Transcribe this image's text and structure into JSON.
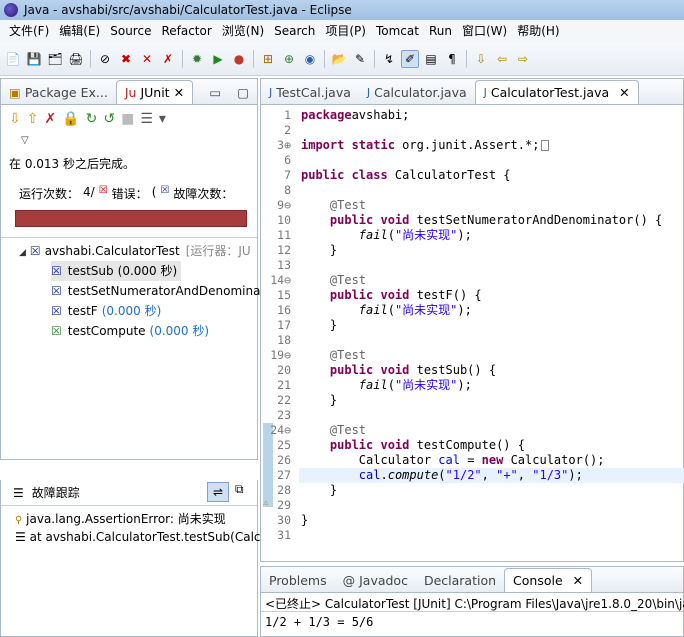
{
  "window": {
    "title": "Java - avshabi/src/avshabi/CalculatorTest.java - Eclipse"
  },
  "menu": [
    "文件(F)",
    "编辑(E)",
    "Source",
    "Refactor",
    "浏览(N)",
    "Search",
    "项目(P)",
    "Tomcat",
    "Run",
    "窗口(W)",
    "帮助(H)"
  ],
  "left_tabs": {
    "package": "Package Ex...",
    "junit": "JUnit"
  },
  "junit": {
    "finished": "在 0.013 秒之后完成。",
    "runs_label": "运行次数：",
    "runs_value": "4/",
    "errors_label": "错误：",
    "errors_value": "(",
    "failures_label": "故障次数：",
    "failures_value": "",
    "tree": {
      "root": "avshabi.CalculatorTest",
      "root_suffix": "[运行器：JU",
      "items": [
        {
          "name": "testSub",
          "time": "(0.000 秒)"
        },
        {
          "name": "testSetNumeratorAndDenomina",
          "time": ""
        },
        {
          "name": "testF",
          "time": "(0.000 秒)"
        },
        {
          "name": "testCompute",
          "time": "(0.000 秒)"
        }
      ]
    },
    "trace_title": "故障跟踪",
    "trace": [
      "java.lang.AssertionError: 尚未实现",
      "at avshabi.CalculatorTest.testSub(Calc"
    ]
  },
  "editor_tabs": [
    "TestCal.java",
    "Calculator.java",
    "CalculatorTest.java"
  ],
  "code": [
    {
      "n": "1",
      "t": [
        [
          "kw",
          "package"
        ],
        [
          "",
          "avshabi;"
        ]
      ]
    },
    {
      "n": "2",
      "t": []
    },
    {
      "n": "3⊕",
      "t": [
        [
          "kw",
          "import static"
        ],
        [
          "",
          " org.junit.Assert.*;"
        ],
        [
          "box",
          ""
        ]
      ]
    },
    {
      "n": "6",
      "t": []
    },
    {
      "n": "7",
      "t": [
        [
          "kw",
          "public class"
        ],
        [
          "",
          " CalculatorTest {"
        ]
      ]
    },
    {
      "n": "8",
      "t": []
    },
    {
      "n": "9⊖",
      "t": [
        [
          "ann",
          "    @Test"
        ]
      ]
    },
    {
      "n": "10",
      "t": [
        [
          "kw",
          "    public void"
        ],
        [
          "",
          " testSetNumeratorAndDenominator() {"
        ]
      ]
    },
    {
      "n": "11",
      "t": [
        [
          "it",
          "        fail"
        ],
        [
          "",
          "("
        ],
        [
          "str",
          "\"尚未实现\""
        ],
        [
          "",
          ");"
        ]
      ]
    },
    {
      "n": "12",
      "t": [
        [
          "",
          "    }"
        ]
      ]
    },
    {
      "n": "13",
      "t": []
    },
    {
      "n": "14⊖",
      "t": [
        [
          "ann",
          "    @Test"
        ]
      ]
    },
    {
      "n": "15",
      "t": [
        [
          "kw",
          "    public void"
        ],
        [
          "",
          " testF() {"
        ]
      ]
    },
    {
      "n": "16",
      "t": [
        [
          "it",
          "        fail"
        ],
        [
          "",
          "("
        ],
        [
          "str",
          "\"尚未实现\""
        ],
        [
          "",
          ");"
        ]
      ]
    },
    {
      "n": "17",
      "t": [
        [
          "",
          "    }"
        ]
      ]
    },
    {
      "n": "18",
      "t": []
    },
    {
      "n": "19⊖",
      "t": [
        [
          "ann",
          "    @Test"
        ]
      ]
    },
    {
      "n": "20",
      "t": [
        [
          "kw",
          "    public void"
        ],
        [
          "",
          " testSub() {"
        ]
      ]
    },
    {
      "n": "21",
      "t": [
        [
          "it",
          "        fail"
        ],
        [
          "",
          "("
        ],
        [
          "str",
          "\"尚未实现\""
        ],
        [
          "",
          ");"
        ]
      ]
    },
    {
      "n": "22",
      "t": [
        [
          "",
          "    }"
        ]
      ]
    },
    {
      "n": "23",
      "t": []
    },
    {
      "n": "24⊖",
      "t": [
        [
          "ann",
          "    @Test"
        ]
      ]
    },
    {
      "n": "25",
      "t": [
        [
          "kw",
          "    public void"
        ],
        [
          "",
          " testCompute() {"
        ]
      ]
    },
    {
      "n": "26",
      "t": [
        [
          "",
          "        Calculator "
        ],
        [
          "fieldv",
          "cal"
        ],
        [
          "",
          " = "
        ],
        [
          "kw",
          "new"
        ],
        [
          "",
          " Calculator();"
        ]
      ]
    },
    {
      "n": "27",
      "t": [
        [
          "fieldv",
          "        cal"
        ],
        [
          "",
          "."
        ],
        [
          "it",
          "compute"
        ],
        [
          "",
          "("
        ],
        [
          "str",
          "\"1/2\""
        ],
        [
          "",
          ", "
        ],
        [
          "str",
          "\"+\""
        ],
        [
          "",
          ", "
        ],
        [
          "str",
          "\"1/3\""
        ],
        [
          "",
          ");"
        ]
      ]
    },
    {
      "n": "28",
      "t": [
        [
          "",
          "    }"
        ]
      ]
    },
    {
      "n": "29",
      "t": []
    },
    {
      "n": "30",
      "t": [
        [
          "",
          "}"
        ]
      ]
    },
    {
      "n": "31",
      "t": []
    }
  ],
  "bottom_tabs": [
    "Problems",
    "@ Javadoc",
    "Declaration",
    "Console"
  ],
  "console": {
    "header": "<已终止> CalculatorTest [JUnit] C:\\Program Files\\Java\\jre1.8.0_20\\bin\\jav",
    "output": "1/2 + 1/3 = 5/6"
  },
  "colors": {
    "failbar": "#a63c3c",
    "keyword": "#7f0055",
    "string": "#2a00ff"
  }
}
